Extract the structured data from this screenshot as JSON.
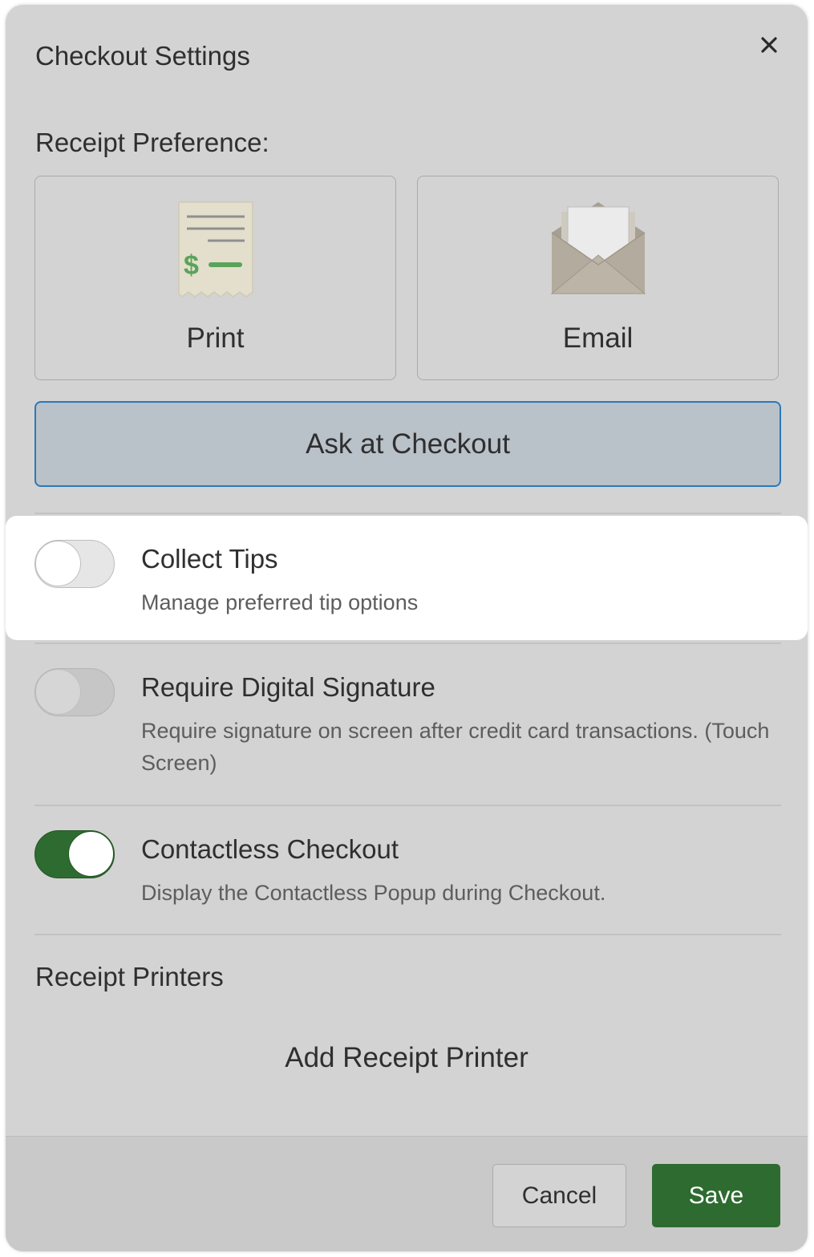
{
  "dialog": {
    "title": "Checkout Settings",
    "close_icon": "close-icon"
  },
  "receipt_preference": {
    "label": "Receipt Preference:",
    "options": [
      {
        "label": "Print",
        "icon": "receipt-icon"
      },
      {
        "label": "Email",
        "icon": "envelope-icon"
      }
    ],
    "ask_label": "Ask at Checkout"
  },
  "settings": [
    {
      "title": "Collect Tips",
      "description": "Manage preferred tip options",
      "enabled": false
    },
    {
      "title": "Require Digital Signature",
      "description": "Require signature on screen after credit card transactions. (Touch Screen)",
      "enabled": false
    },
    {
      "title": "Contactless Checkout",
      "description": "Display the Contactless Popup during Checkout.",
      "enabled": true
    }
  ],
  "receipt_printers": {
    "label": "Receipt Printers",
    "add_label": "Add Receipt Printer"
  },
  "footer": {
    "cancel_label": "Cancel",
    "save_label": "Save"
  },
  "colors": {
    "accent_green": "#2e6b30",
    "selection_border": "#2c79b8",
    "icon_green": "#5aa35a",
    "envelope": "#b3ab9d"
  }
}
